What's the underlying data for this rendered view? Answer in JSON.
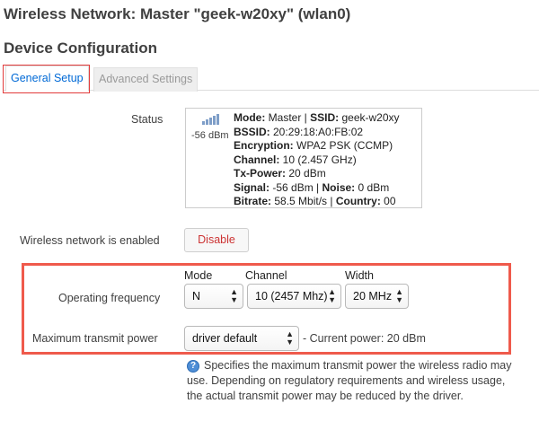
{
  "page": {
    "title": "Wireless Network: Master \"geek-w20xy\" (wlan0)",
    "section_title": "Device Configuration"
  },
  "tabs": {
    "general": "General Setup",
    "advanced": "Advanced Settings"
  },
  "status": {
    "label": "Status",
    "signal_dbm": "-56 dBm",
    "mode_label": "Mode:",
    "mode_value": " Master | ",
    "ssid_label": "SSID:",
    "ssid_value": " geek-w20xy",
    "bssid_label": "BSSID:",
    "bssid_value": " 20:29:18:A0:FB:02",
    "encryption_label": "Encryption:",
    "encryption_value": " WPA2 PSK (CCMP)",
    "channel_label": "Channel:",
    "channel_value": " 10 (2.457 GHz)",
    "txpower_label": "Tx-Power:",
    "txpower_value": " 20 dBm",
    "signal_label": "Signal:",
    "signal_value": " -56 dBm | ",
    "noise_label": "Noise:",
    "noise_value": " 0 dBm",
    "bitrate_label": "Bitrate:",
    "bitrate_value": " 58.5 Mbit/s | ",
    "country_label": "Country:",
    "country_value": " 00"
  },
  "enabled": {
    "label": "Wireless network is enabled",
    "button": "Disable"
  },
  "frequency": {
    "label": "Operating frequency",
    "mode_head": "Mode",
    "channel_head": "Channel",
    "width_head": "Width",
    "mode_value": "N",
    "channel_value": "10 (2457 Mhz)",
    "width_value": "20 MHz"
  },
  "txpower": {
    "label": "Maximum transmit power",
    "value": "driver default",
    "current": "- Current power: 20 dBm",
    "help_icon": "?",
    "help_line1": "Specifies the maximum transmit power the wireless radio may",
    "help_line2": "use. Depending on regulatory requirements and wireless usage,",
    "help_line3": "the actual transmit power may be reduced by the driver."
  },
  "icons": {
    "signal": "signal-strength-icon",
    "help": "help-icon",
    "select_arrows": "up-down-arrows-icon"
  },
  "colors": {
    "highlight": "#ef5a4c",
    "tab_active_text": "#0069d6",
    "disable_text": "#cc3333"
  }
}
